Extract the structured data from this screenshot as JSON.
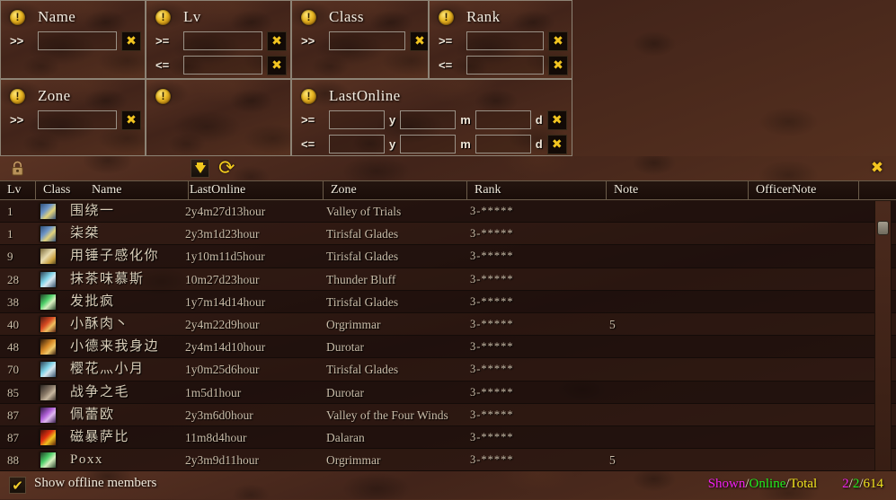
{
  "filters": {
    "panels": [
      {
        "id": "name",
        "icon": "warning-icon",
        "title": "Name",
        "rows": [
          {
            "op": ">>",
            "value": "",
            "placeholder": ""
          }
        ]
      },
      {
        "id": "lv",
        "icon": "warning-icon",
        "title": "Lv",
        "rows": [
          {
            "op": ">=",
            "value": "",
            "placeholder": ""
          },
          {
            "op": "<=",
            "value": "",
            "placeholder": ""
          }
        ]
      },
      {
        "id": "class",
        "icon": "warning-icon",
        "title": "Class",
        "rows": [
          {
            "op": ">>",
            "value": "",
            "placeholder": ""
          }
        ]
      },
      {
        "id": "rank",
        "icon": "warning-icon",
        "title": "Rank",
        "rows": [
          {
            "op": ">=",
            "value": "",
            "placeholder": ""
          },
          {
            "op": "<=",
            "value": "",
            "placeholder": ""
          }
        ]
      },
      {
        "id": "zone",
        "icon": "warning-icon",
        "title": "Zone",
        "rows": [
          {
            "op": ">>",
            "value": "",
            "placeholder": ""
          }
        ]
      },
      {
        "id": "blank",
        "icon": "warning-icon",
        "title": "",
        "rows": []
      },
      {
        "id": "lastonline",
        "icon": "warning-icon",
        "title": "LastOnline",
        "rows": [
          {
            "op": ">=",
            "y": "",
            "m": "",
            "d": ""
          },
          {
            "op": "<=",
            "y": "",
            "m": "",
            "d": ""
          }
        ]
      }
    ],
    "units": {
      "y": "y",
      "m": "m",
      "d": "d"
    },
    "clear_button": "clear-filter-button",
    "apply_button": "apply-filter-button"
  },
  "roster": {
    "titlebar": {
      "lock_icon": "lock-icon",
      "download_icon": "download-icon",
      "refresh_icon": "refresh-icon",
      "close_icon": "close-icon"
    },
    "columns": [
      {
        "key": "lv",
        "label": "Lv"
      },
      {
        "key": "class",
        "label": "Class"
      },
      {
        "key": "name",
        "label": "Name"
      },
      {
        "key": "lastonline",
        "label": "LastOnline"
      },
      {
        "key": "zone",
        "label": "Zone"
      },
      {
        "key": "rank",
        "label": "Rank"
      },
      {
        "key": "note",
        "label": "Note"
      },
      {
        "key": "officernote",
        "label": "OfficerNote"
      }
    ],
    "rows": [
      {
        "lv": "1",
        "class_icon": "sword-blue-icon",
        "name": "围绕一",
        "lastonline": "2y4m27d13hour",
        "zone": "Valley of Trials",
        "rank": "3-*****",
        "note": "",
        "officernote": ""
      },
      {
        "lv": "1",
        "class_icon": "sword-blue-icon",
        "name": "柒桀",
        "lastonline": "2y3m1d23hour",
        "zone": "Tirisfal Glades",
        "rank": "3-*****",
        "note": "",
        "officernote": ""
      },
      {
        "lv": "9",
        "class_icon": "scroll-gold-icon",
        "name": "用锤子感化你",
        "lastonline": "1y10m11d5hour",
        "zone": "Tirisfal Glades",
        "rank": "3-*****",
        "note": "",
        "officernote": ""
      },
      {
        "lv": "28",
        "class_icon": "dagger-cyan-icon",
        "name": "抹茶味慕斯",
        "lastonline": "10m27d23hour",
        "zone": "Thunder Bluff",
        "rank": "3-*****",
        "note": "",
        "officernote": ""
      },
      {
        "lv": "38",
        "class_icon": "blades-green-icon",
        "name": "发批疯",
        "lastonline": "1y7m14d14hour",
        "zone": "Tirisfal Glades",
        "rank": "3-*****",
        "note": "",
        "officernote": ""
      },
      {
        "lv": "40",
        "class_icon": "arrow-red-icon",
        "name": "小酥肉丶",
        "lastonline": "2y4m22d9hour",
        "zone": "Orgrimmar",
        "rank": "3-*****",
        "note": "5",
        "officernote": ""
      },
      {
        "lv": "48",
        "class_icon": "staff-orange-icon",
        "name": "小德来我身边",
        "lastonline": "2y4m14d10hour",
        "zone": "Durotar",
        "rank": "3-*****",
        "note": "",
        "officernote": ""
      },
      {
        "lv": "70",
        "class_icon": "dagger-cyan-icon",
        "name": "樱花灬小月",
        "lastonline": "1y0m25d6hour",
        "zone": "Tirisfal Glades",
        "rank": "3-*****",
        "note": "",
        "officernote": ""
      },
      {
        "lv": "85",
        "class_icon": "claw-grey-icon",
        "name": "战争之毛",
        "lastonline": "1m5d1hour",
        "zone": "Durotar",
        "rank": "3-*****",
        "note": "",
        "officernote": ""
      },
      {
        "lv": "87",
        "class_icon": "shadow-purple-icon",
        "name": "佩蕾欧",
        "lastonline": "2y3m6d0hour",
        "zone": "Valley of the Four Winds",
        "rank": "3-*****",
        "note": "",
        "officernote": ""
      },
      {
        "lv": "87",
        "class_icon": "fire-totem-icon",
        "name": "磁暴萨比",
        "lastonline": "11m8d4hour",
        "zone": "Dalaran",
        "rank": "3-*****",
        "note": "",
        "officernote": ""
      },
      {
        "lv": "88",
        "class_icon": "blades-green-icon",
        "name": "Poxx",
        "lastonline": "2y3m9d11hour",
        "zone": "Orgrimmar",
        "rank": "3-*****",
        "note": "5",
        "officernote": ""
      }
    ],
    "scrollbar": {
      "name": "roster-scrollbar"
    }
  },
  "statusbar": {
    "show_offline_label": "Show offline members",
    "show_offline_checked": true,
    "legend": {
      "shown": "Shown",
      "online": "Online",
      "total": "Total",
      "sep": "/"
    },
    "counts": {
      "shown": "2",
      "online": "2",
      "total": "614"
    }
  },
  "colors": {
    "shown": "#f11ff1",
    "online": "#1ef01e",
    "total": "#f0e41e",
    "accent_gold": "#f2c420"
  }
}
